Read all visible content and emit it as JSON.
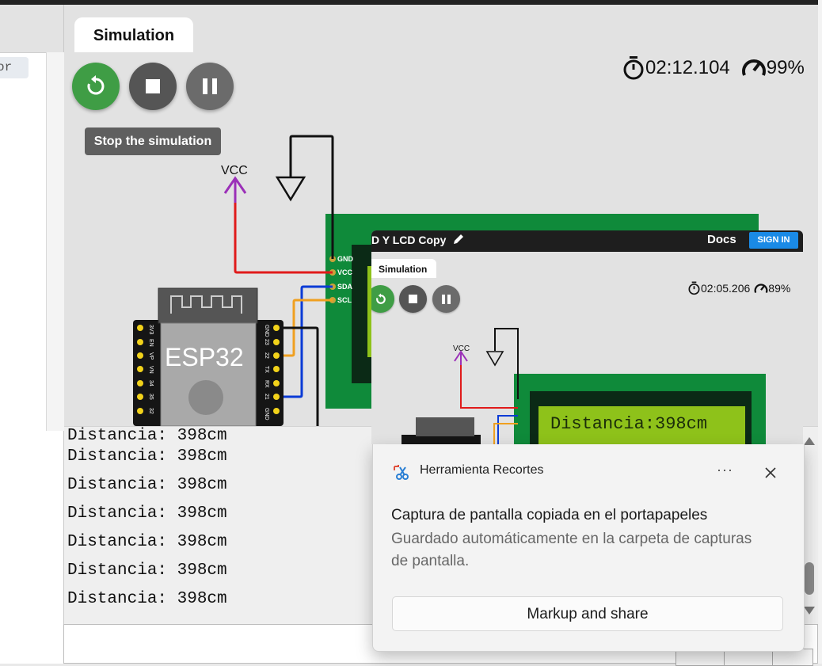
{
  "editor": {
    "left_tag": "or"
  },
  "simulation": {
    "tab_label": "Simulation",
    "controls": {
      "restart_icon": "restart-icon",
      "stop_icon": "stop-icon",
      "pause_icon": "pause-icon"
    },
    "tooltip": "Stop the simulation",
    "timer": "02:12.104",
    "speed": "99%",
    "vcc_label": "VCC",
    "board_label": "ESP32",
    "lcd_pins": [
      "GND",
      "VCC",
      "SDA",
      "SCL"
    ],
    "board_pins_left": [
      "3V3",
      "EN",
      "VP",
      "VN",
      "34",
      "35",
      "32"
    ],
    "board_pins_right": [
      "GND",
      "23",
      "22",
      "TX",
      "RX",
      "21",
      "GND"
    ]
  },
  "serial_monitor": {
    "lines": [
      "Distancia: 398cm",
      "Distancia: 398cm",
      "Distancia: 398cm",
      "Distancia: 398cm",
      "Distancia: 398cm",
      "Distancia: 398cm",
      "Distancia: 398cm"
    ]
  },
  "snip_preview": {
    "project_title": "D Y LCD Copy",
    "docs_label": "Docs",
    "sign_in_label": "SIGN IN",
    "tab_label": "Simulation",
    "timer": "02:05.206",
    "speed": "89%",
    "vcc_label": "VCC",
    "lcd_text": "Distancia:398cm"
  },
  "notification": {
    "app_name": "Herramienta Recortes",
    "more_label": "···",
    "title": "Captura de pantalla copiada en el portapapeles",
    "body": "Guardado automáticamente en la carpeta de capturas de pantalla.",
    "action_label": "Markup and share"
  },
  "colors": {
    "restart_green": "#3f9d45",
    "wire_red": "#e01b1b",
    "wire_blue": "#0b3bd6",
    "wire_orange": "#f0a020",
    "board_green": "#0f8a3a",
    "lcd_backlight": "#8ec21a",
    "sign_in_blue": "#1a8ae6"
  }
}
